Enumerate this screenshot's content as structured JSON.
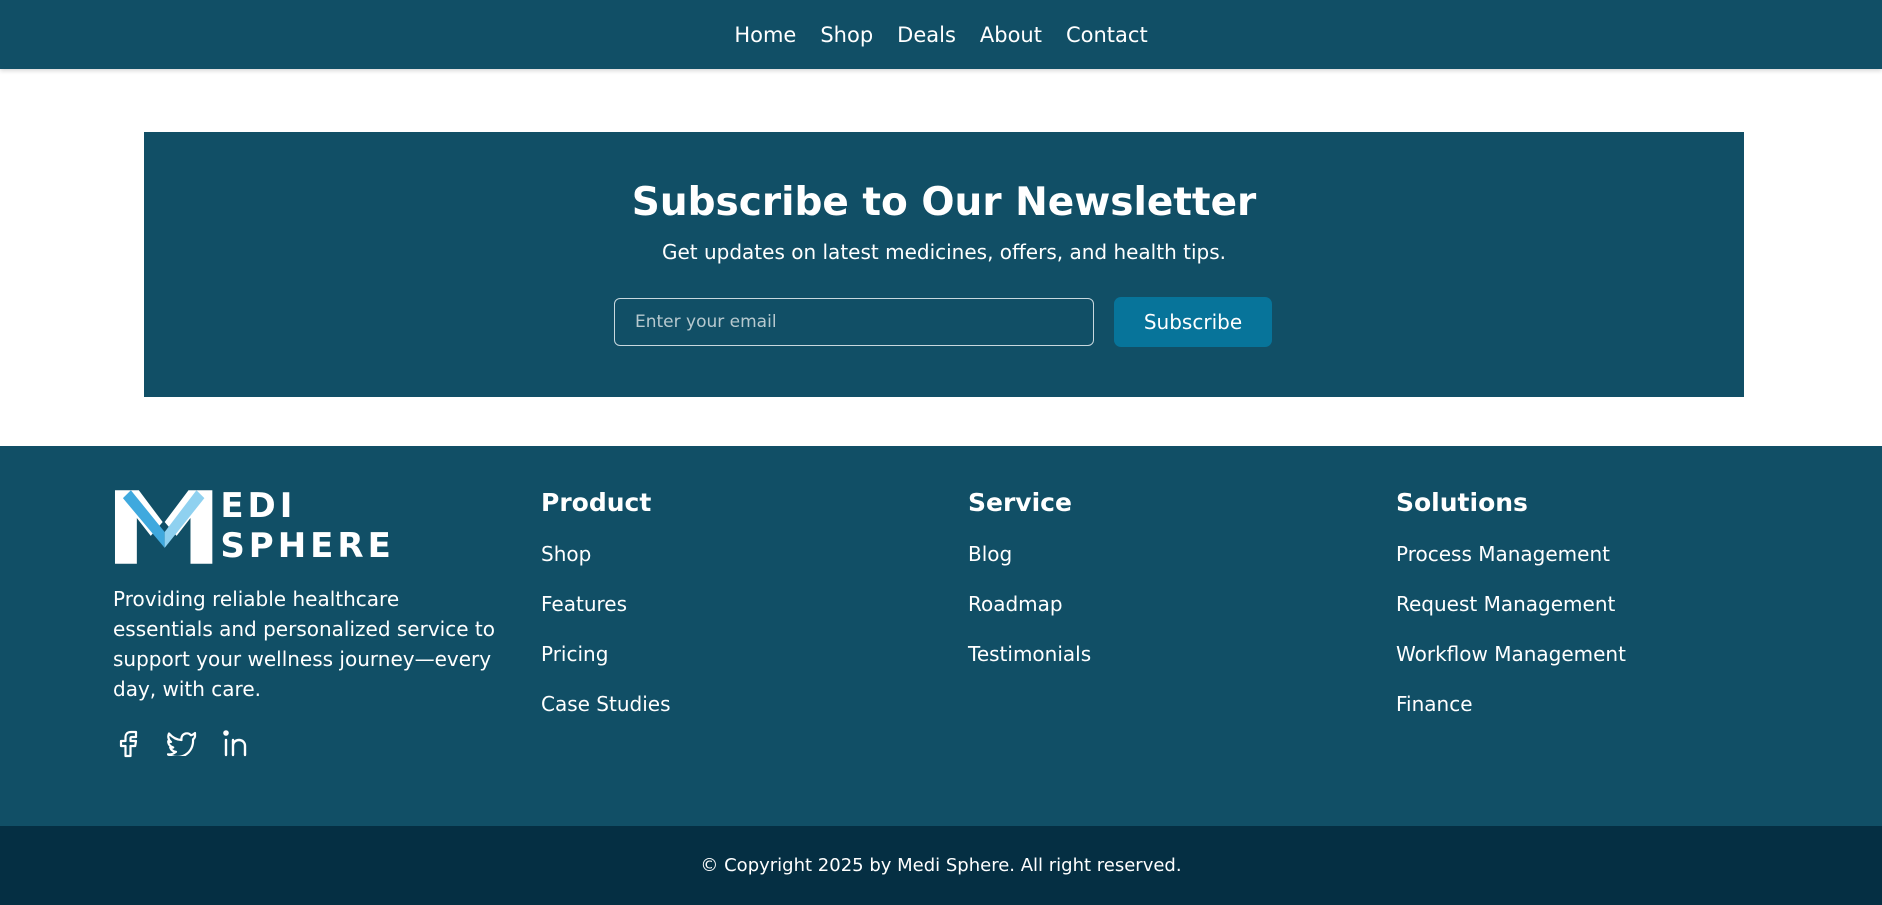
{
  "nav": {
    "items": [
      "Home",
      "Shop",
      "Deals",
      "About",
      "Contact"
    ]
  },
  "newsletter": {
    "title": "Subscribe to Our Newsletter",
    "subtitle": "Get updates on latest medicines, offers, and health tips.",
    "email_placeholder": "Enter your email",
    "button_label": "Subscribe"
  },
  "brand": {
    "logo_text": "EDI SPHERE",
    "description": "Providing reliable healthcare essentials and personalized service to support your wellness journey—every day, with care.",
    "socials": [
      "facebook-icon",
      "twitter-icon",
      "linkedin-icon"
    ]
  },
  "columns": [
    {
      "heading": "Product",
      "links": [
        "Shop",
        "Features",
        "Pricing",
        "Case Studies"
      ]
    },
    {
      "heading": "Service",
      "links": [
        "Blog",
        "Roadmap",
        "Testimonials"
      ]
    },
    {
      "heading": "Solutions",
      "links": [
        "Process Management",
        "Request Management",
        "Workflow Management",
        "Finance"
      ]
    }
  ],
  "copyright": "© Copyright 2025 by Medi Sphere. All right reserved.",
  "colors": {
    "primary": "#114f66",
    "accent_button": "#07749a",
    "bottom_bar": "#052f43",
    "logo_light": "#ffffff",
    "logo_blue": "#3fa9de"
  }
}
